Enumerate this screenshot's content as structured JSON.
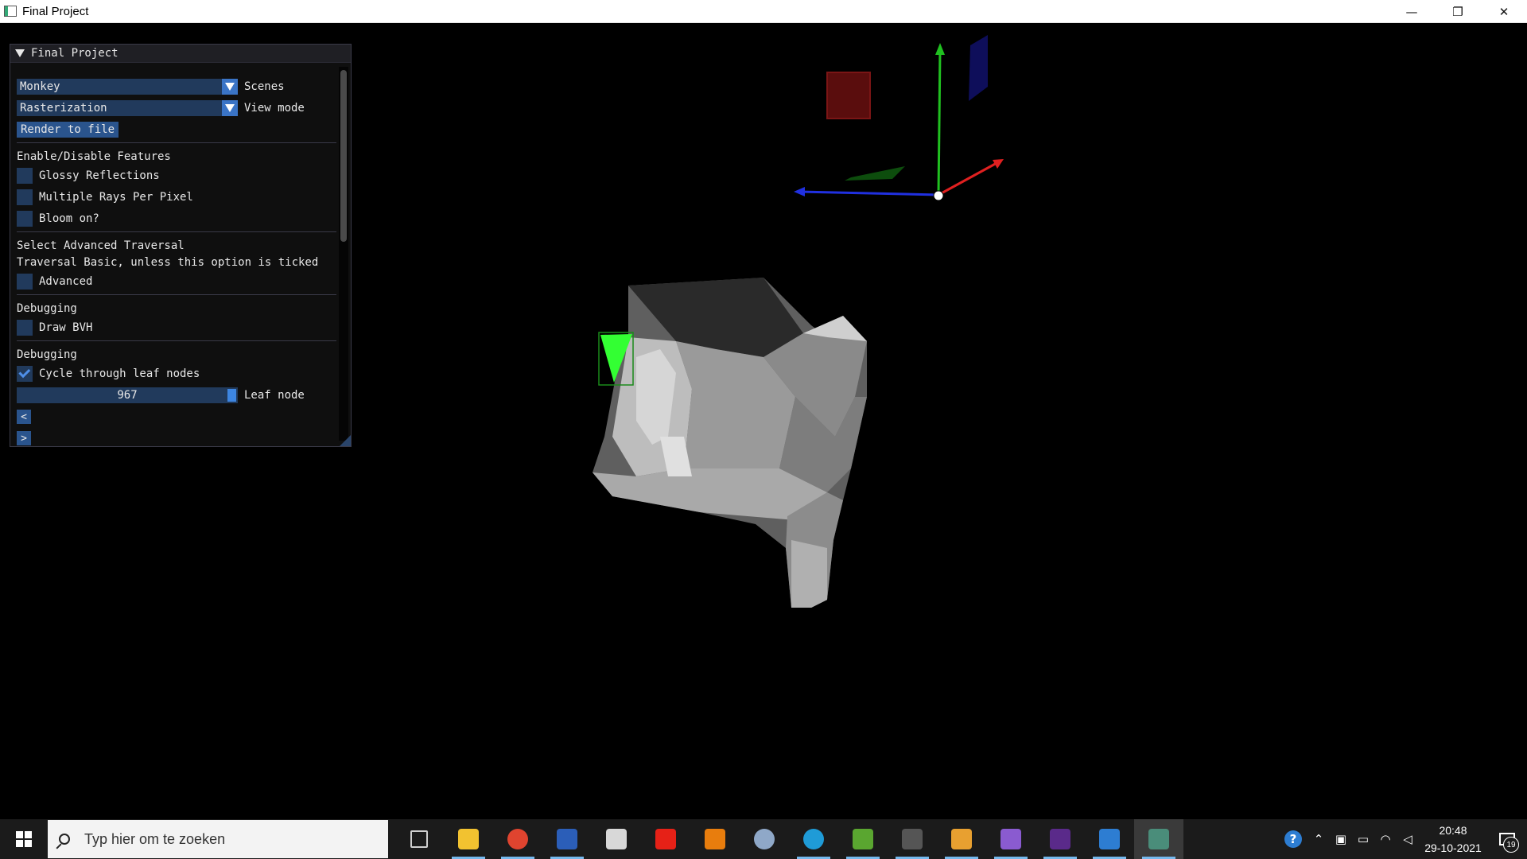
{
  "window": {
    "title": "Final Project",
    "minimize_glyph": "—",
    "maximize_glyph": "❐",
    "close_glyph": "✕"
  },
  "panel": {
    "title": "Final Project",
    "scenes_value": "Monkey",
    "scenes_label": "Scenes",
    "view_mode_value": "Rasterization",
    "view_mode_label": "View mode",
    "render_button": "Render to file",
    "features_header": "Enable/Disable Features",
    "glossy_label": "Glossy Reflections",
    "glossy_checked": false,
    "multi_rays_label": "Multiple Rays Per Pixel",
    "multi_rays_checked": false,
    "bloom_label": "Bloom on?",
    "bloom_checked": false,
    "traversal_header": "Select Advanced Traversal",
    "traversal_note": "Traversal Basic, unless this option is ticked",
    "advanced_label": "Advanced",
    "advanced_checked": false,
    "debug_header_1": "Debugging",
    "draw_bvh_label": "Draw BVH",
    "draw_bvh_checked": false,
    "debug_header_2": "Debugging",
    "cycle_leaf_label": "Cycle through leaf nodes",
    "cycle_leaf_checked": true,
    "leaf_slider_value": "967",
    "leaf_slider_label": "Leaf node",
    "prev_button": "<",
    "next_button": ">"
  },
  "viewport": {
    "gizmo_axis_colors": {
      "x": "#e02020",
      "y": "#20c020",
      "z": "#2030e0"
    },
    "highlight_color": "#33ff33"
  },
  "taskbar": {
    "search_placeholder": "Typ hier om te zoeken",
    "time": "20:48",
    "date": "29-10-2021",
    "notification_count": "19",
    "pinned": [
      {
        "name": "task-view-icon",
        "color": "#cfcfcf"
      },
      {
        "name": "file-explorer-icon",
        "color": "#f2c230"
      },
      {
        "name": "chrome-icon",
        "color": "#e0442f"
      },
      {
        "name": "word-icon",
        "color": "#2b5eb8"
      },
      {
        "name": "store-icon",
        "color": "#d8d8d8"
      },
      {
        "name": "youtube-icon",
        "color": "#e62117"
      },
      {
        "name": "blender-icon",
        "color": "#e87d0d"
      },
      {
        "name": "paint-icon",
        "color": "#8fa8c8"
      },
      {
        "name": "edge-icon",
        "color": "#1f9bd7"
      },
      {
        "name": "maps-app-icon",
        "color": "#5aa630"
      },
      {
        "name": "terminal-icon",
        "color": "#555555"
      },
      {
        "name": "git-icon",
        "color": "#e8a030"
      },
      {
        "name": "visual-studio-icon",
        "color": "#8a5bd0"
      },
      {
        "name": "console-icon",
        "color": "#5a2a8a"
      },
      {
        "name": "photos-icon",
        "color": "#2d7dd2"
      },
      {
        "name": "final-project-app-icon",
        "color": "#4a8d7a"
      }
    ]
  }
}
